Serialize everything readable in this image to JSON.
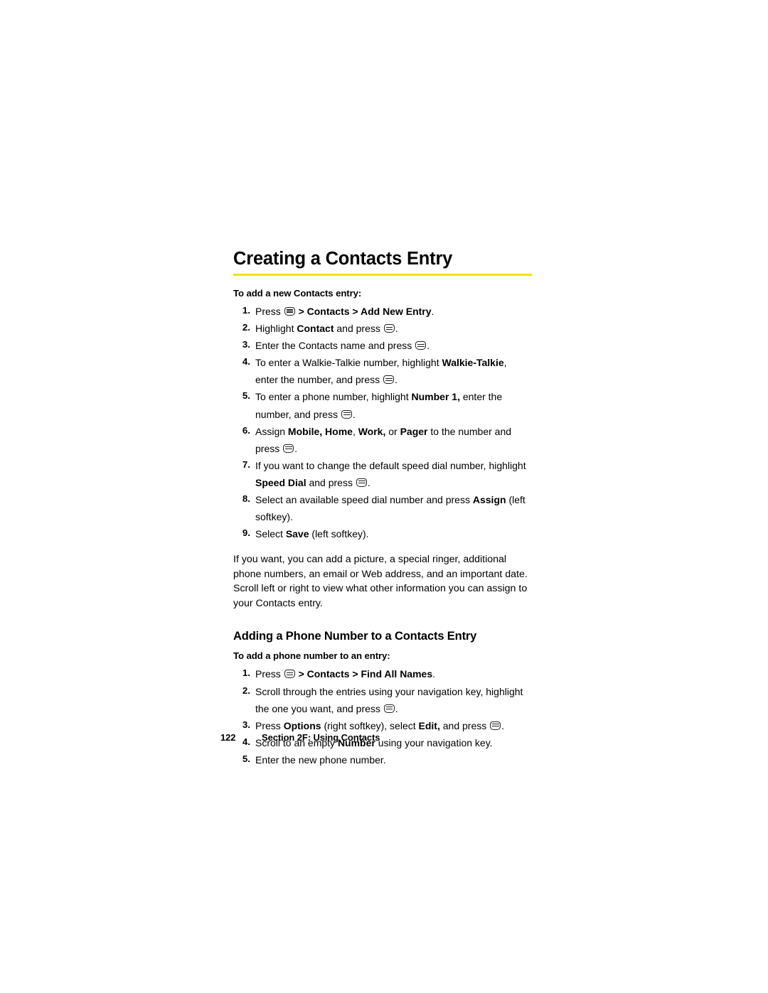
{
  "page": {
    "title": "Creating a Contacts Entry",
    "rule_color": "#f5e100",
    "section_one": {
      "lead": "To add a new Contacts entry:",
      "steps": [
        {
          "num": "1.",
          "parts": [
            {
              "t": "text",
              "v": "Press "
            },
            {
              "t": "icon",
              "v": "menu-key-icon"
            },
            {
              "t": "bold",
              "v": " > Contacts > Add New Entry"
            },
            {
              "t": "text",
              "v": "."
            }
          ]
        },
        {
          "num": "2.",
          "parts": [
            {
              "t": "text",
              "v": "Highlight "
            },
            {
              "t": "bold",
              "v": "Contact"
            },
            {
              "t": "text",
              "v": " and press "
            },
            {
              "t": "icon",
              "v": "menu-key-icon"
            },
            {
              "t": "text",
              "v": "."
            }
          ]
        },
        {
          "num": "3.",
          "parts": [
            {
              "t": "text",
              "v": "Enter the Contacts name and press "
            },
            {
              "t": "icon",
              "v": "menu-key-icon"
            },
            {
              "t": "text",
              "v": "."
            }
          ]
        },
        {
          "num": "4.",
          "parts": [
            {
              "t": "text",
              "v": "To enter a Walkie-Talkie number, highlight "
            },
            {
              "t": "bold",
              "v": "Walkie-Talkie"
            },
            {
              "t": "text",
              "v": ", enter the number, and press "
            },
            {
              "t": "icon",
              "v": "menu-key-icon"
            },
            {
              "t": "text",
              "v": "."
            }
          ]
        },
        {
          "num": "5.",
          "parts": [
            {
              "t": "text",
              "v": "To enter a phone number, highlight "
            },
            {
              "t": "bold",
              "v": "Number 1,"
            },
            {
              "t": "text",
              "v": " enter the number, and press "
            },
            {
              "t": "icon",
              "v": "menu-key-icon"
            },
            {
              "t": "text",
              "v": "."
            }
          ]
        },
        {
          "num": "6.",
          "parts": [
            {
              "t": "text",
              "v": "Assign "
            },
            {
              "t": "bold",
              "v": "Mobile, Home"
            },
            {
              "t": "text",
              "v": ", "
            },
            {
              "t": "bold",
              "v": "Work,"
            },
            {
              "t": "text",
              "v": " or "
            },
            {
              "t": "bold",
              "v": "Pager"
            },
            {
              "t": "text",
              "v": " to the number and press "
            },
            {
              "t": "icon",
              "v": "menu-key-icon"
            },
            {
              "t": "text",
              "v": "."
            }
          ]
        },
        {
          "num": "7.",
          "parts": [
            {
              "t": "text",
              "v": "If you want to change the default speed dial number, highlight "
            },
            {
              "t": "bold",
              "v": "Speed Dial"
            },
            {
              "t": "text",
              "v": " and press "
            },
            {
              "t": "icon",
              "v": "menu-key-icon"
            },
            {
              "t": "text",
              "v": "."
            }
          ]
        },
        {
          "num": "8.",
          "parts": [
            {
              "t": "text",
              "v": "Select an available speed dial number and press "
            },
            {
              "t": "bold",
              "v": "Assign"
            },
            {
              "t": "text",
              "v": " (left softkey)."
            }
          ]
        },
        {
          "num": "9.",
          "parts": [
            {
              "t": "text",
              "v": "Select "
            },
            {
              "t": "bold",
              "v": "Save"
            },
            {
              "t": "text",
              "v": " (left softkey)."
            }
          ]
        }
      ],
      "paragraph": "If you want, you can add a picture, a special ringer, additional phone numbers, an email or Web address, and an important date. Scroll left or right to view what other information you can assign to your Contacts entry."
    },
    "section_two": {
      "heading": "Adding a Phone Number to a Contacts Entry",
      "lead": "To add a phone number to an entry:",
      "steps": [
        {
          "num": "1.",
          "parts": [
            {
              "t": "text",
              "v": "Press "
            },
            {
              "t": "icon",
              "v": "menu-key-icon"
            },
            {
              "t": "bold",
              "v": " > Contacts > Find All Names"
            },
            {
              "t": "text",
              "v": "."
            }
          ]
        },
        {
          "num": "2.",
          "parts": [
            {
              "t": "text",
              "v": "Scroll through the entries using your navigation key, highlight the one you want, and press "
            },
            {
              "t": "icon",
              "v": "menu-key-icon"
            },
            {
              "t": "text",
              "v": "."
            }
          ]
        },
        {
          "num": "3.",
          "parts": [
            {
              "t": "text",
              "v": "Press "
            },
            {
              "t": "bold",
              "v": "Options"
            },
            {
              "t": "text",
              "v": " (right softkey), select "
            },
            {
              "t": "bold",
              "v": "Edit,"
            },
            {
              "t": "text",
              "v": " and press "
            },
            {
              "t": "icon",
              "v": "menu-key-icon"
            },
            {
              "t": "text",
              "v": "."
            }
          ]
        },
        {
          "num": "4.",
          "parts": [
            {
              "t": "text",
              "v": "Scroll to an empty "
            },
            {
              "t": "bold",
              "v": "Number"
            },
            {
              "t": "text",
              "v": " using your navigation key."
            }
          ]
        },
        {
          "num": "5.",
          "parts": [
            {
              "t": "text",
              "v": "Enter the new phone number."
            }
          ]
        }
      ]
    },
    "footer": {
      "page_number": "122",
      "section_label": "Section 2F: Using Contacts"
    }
  }
}
